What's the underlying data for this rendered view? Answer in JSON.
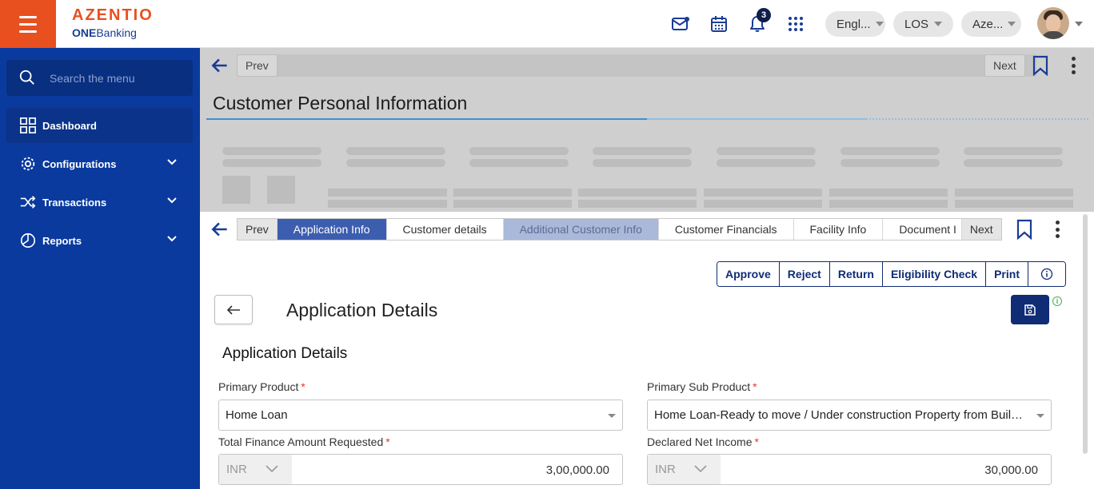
{
  "brand": {
    "name": "AZENTIO",
    "tagline_bold": "ONE",
    "tagline_rest": "Banking"
  },
  "header": {
    "notifications_count": "3",
    "language": "Engl...",
    "module": "LOS",
    "entity": "Aze..."
  },
  "sidebar": {
    "search_placeholder": "Search the menu",
    "items": [
      {
        "label": "Dashboard",
        "icon": "dashboard-grid-icon"
      },
      {
        "label": "Configurations",
        "icon": "gear-icon"
      },
      {
        "label": "Transactions",
        "icon": "shuffle-icon"
      },
      {
        "label": "Reports",
        "icon": "pie-chart-icon"
      }
    ]
  },
  "outer": {
    "prev_label": "Prev",
    "next_label": "Next",
    "title": "Customer Personal Information"
  },
  "tabs": {
    "prev_label": "Prev",
    "next_label": "Next",
    "items": [
      {
        "label": "Application Info"
      },
      {
        "label": "Customer details"
      },
      {
        "label": "Additional Customer Info"
      },
      {
        "label": "Customer Financials"
      },
      {
        "label": "Facility Info"
      },
      {
        "label": "Document I"
      }
    ]
  },
  "actions": {
    "approve": "Approve",
    "reject": "Reject",
    "return": "Return",
    "eligibility": "Eligibility Check",
    "print": "Print"
  },
  "page": {
    "title": "Application Details",
    "section_title": "Application Details"
  },
  "form": {
    "primary_product": {
      "label": "Primary Product",
      "value": "Home Loan"
    },
    "primary_sub_product": {
      "label": "Primary Sub Product",
      "value": "Home Loan-Ready to move / Under construction Property from Builder"
    },
    "finance_amount": {
      "label": "Total Finance Amount Requested",
      "currency": "INR",
      "value": "3,00,000.00"
    },
    "net_income": {
      "label": "Declared Net Income",
      "currency": "INR",
      "value": "30,000.00"
    }
  },
  "colors": {
    "accent": "#e8501f",
    "sidebar": "#0a3a9e",
    "primary": "#0f2c75",
    "active_tab": "#3d5eaf"
  }
}
